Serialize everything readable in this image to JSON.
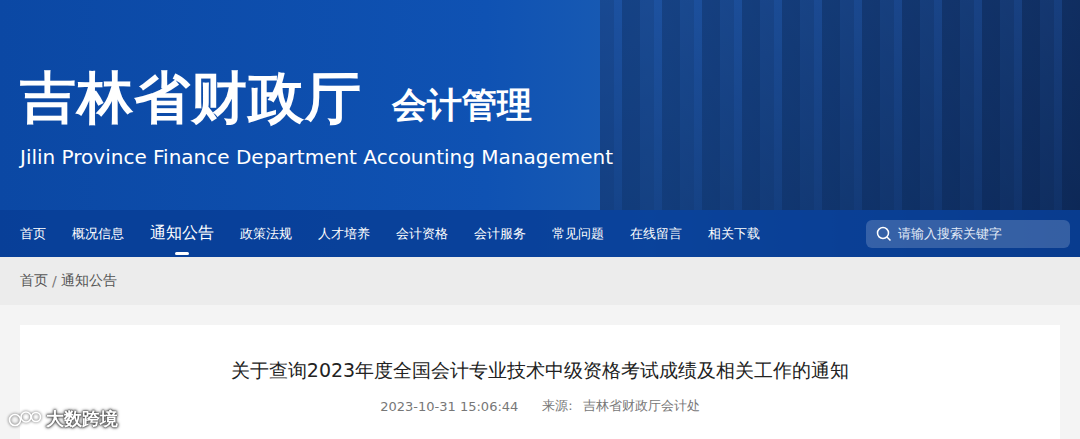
{
  "header": {
    "title": "吉林省财政厅",
    "subtitle": "会计管理",
    "english": "Jilin Province Finance Department Accounting Management"
  },
  "nav": {
    "items": [
      {
        "label": "首页",
        "selected": false
      },
      {
        "label": "概况信息",
        "selected": false
      },
      {
        "label": "通知公告",
        "selected": true
      },
      {
        "label": "政策法规",
        "selected": false
      },
      {
        "label": "人才培养",
        "selected": false
      },
      {
        "label": "会计资格",
        "selected": false
      },
      {
        "label": "会计服务",
        "selected": false
      },
      {
        "label": "常见问题",
        "selected": false
      },
      {
        "label": "在线留言",
        "selected": false
      },
      {
        "label": "相关下载",
        "selected": false
      }
    ]
  },
  "search": {
    "placeholder": "请输入搜索关键字"
  },
  "breadcrumb": {
    "items": [
      "首页",
      "通知公告"
    ],
    "separator": "/"
  },
  "article": {
    "title": "关于查询2023年度全国会计专业技术中级资格考试成绩及相关工作的通知",
    "date": "2023-10-31 15:06:44",
    "source_label": "来源:",
    "source": "吉林省财政厅会计处"
  },
  "watermark": {
    "text": "大数跨境"
  }
}
